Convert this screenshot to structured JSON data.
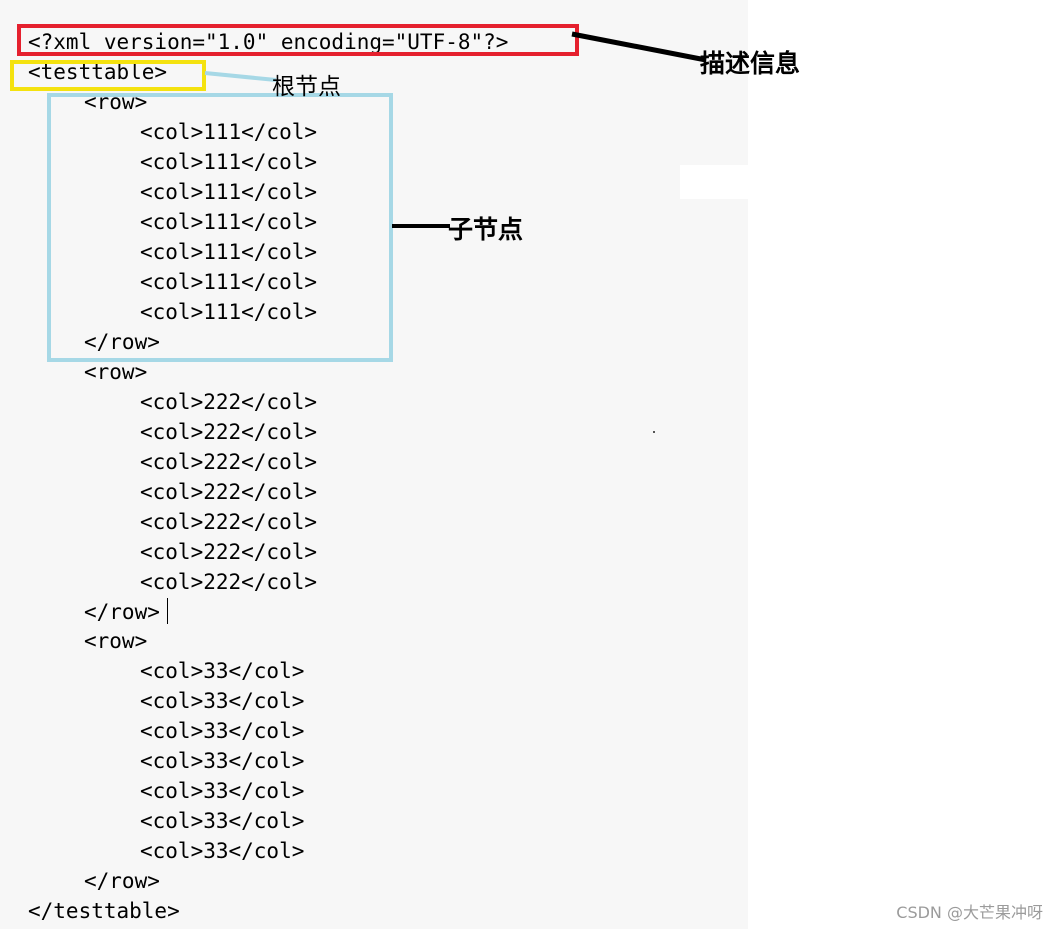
{
  "code": {
    "declaration": "<?xml version=\"1.0\" encoding=\"UTF-8\"?>",
    "root_open": "<testtable>",
    "root_close": "</testtable>",
    "rows": [
      {
        "open": "<row>",
        "close": "</row>",
        "cols": [
          "<col>111</col>",
          "<col>111</col>",
          "<col>111</col>",
          "<col>111</col>",
          "<col>111</col>",
          "<col>111</col>",
          "<col>111</col>"
        ]
      },
      {
        "open": "<row>",
        "close": "</row>",
        "cols": [
          "<col>222</col>",
          "<col>222</col>",
          "<col>222</col>",
          "<col>222</col>",
          "<col>222</col>",
          "<col>222</col>",
          "<col>222</col>"
        ]
      },
      {
        "open": "<row>",
        "close": "</row>",
        "cols": [
          "<col>33</col>",
          "<col>33</col>",
          "<col>33</col>",
          "<col>33</col>",
          "<col>33</col>",
          "<col>33</col>",
          "<col>33</col>"
        ]
      }
    ]
  },
  "annotations": {
    "description": "描述信息",
    "root_node": "根节点",
    "child_node": "子节点"
  },
  "watermark": "CSDN @大芒果冲呀",
  "colors": {
    "declaration_box": "#e5202e",
    "root_box": "#f4e20f",
    "child_box": "#a6d8e6",
    "leader": "#000000"
  }
}
